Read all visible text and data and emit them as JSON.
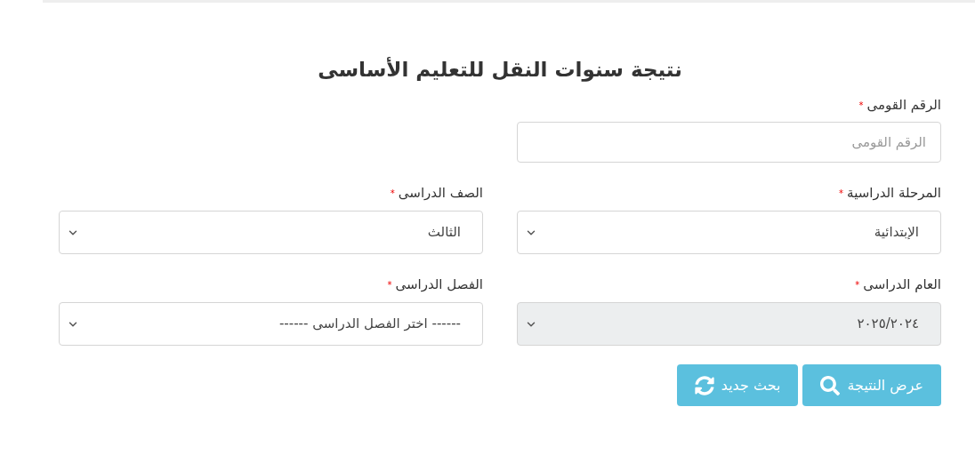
{
  "title": "نتيجة سنوات النقل للتعليم الأساسى",
  "rows": [
    [
      {
        "kind": "text",
        "label": "الرقم القومى",
        "required_mark": "*",
        "placeholder": "الرقم القومى",
        "disabled": false
      }
    ],
    [
      {
        "kind": "select",
        "label": "المرحلة الدراسية",
        "required_mark": "*",
        "value": "الإبتدائية",
        "disabled": false
      },
      {
        "kind": "select",
        "label": "الصف الدراسى",
        "required_mark": "*",
        "value": "الثالث",
        "disabled": false
      }
    ],
    [
      {
        "kind": "select",
        "label": "العام الدراسى",
        "required_mark": "*",
        "value": "٢٠٢٥/٢٠٢٤",
        "disabled": true
      },
      {
        "kind": "select",
        "label": "الفصل الدراسى",
        "required_mark": "*",
        "value": "------ اختر الفصل الدراسى ------",
        "disabled": false
      }
    ]
  ],
  "buttons": [
    {
      "kind": "search",
      "label": "عرض النتيجة"
    },
    {
      "kind": "refresh",
      "label": "بحث جديد"
    }
  ]
}
